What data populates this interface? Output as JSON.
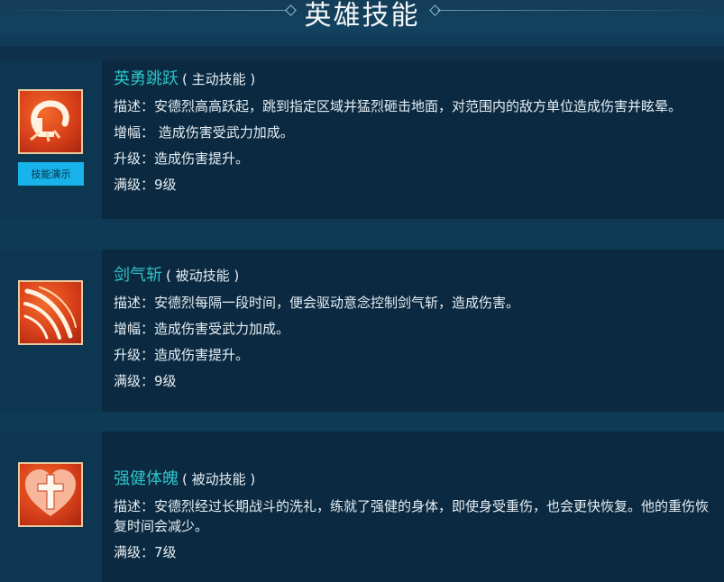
{
  "page": {
    "title": "英雄技能"
  },
  "skills": [
    {
      "name": "英勇跳跃",
      "type": "( 主动技能 )",
      "description": "描述：安德烈高高跃起，跳到指定区域并猛烈砸击地面，对范围内的敌方单位造成伤害并眩晕。",
      "boost": "增幅： 造成伤害受武力加成。",
      "upgrade": "升级：造成伤害提升。",
      "max_level": "满级：9级",
      "demo_label": "技能演示",
      "icon": "leap-slam-icon"
    },
    {
      "name": "剑气斩",
      "type": "( 被动技能 )",
      "description": "描述：安德烈每隔一段时间，便会驱动意念控制剑气斩，造成伤害。",
      "boost": "增幅：造成伤害受武力加成。",
      "upgrade": "升级：造成伤害提升。",
      "max_level": "满级：9级",
      "icon": "sword-wave-icon"
    },
    {
      "name": "强健体魄",
      "type": "( 被动技能 )",
      "description": "描述：安德烈经过长期战斗的洗礼，练就了强健的身体，即使身受重伤，也会更快恢复。他的重伤恢复时间会减少。",
      "max_level": "满级：7级",
      "icon": "heart-cross-icon"
    }
  ],
  "colors": {
    "accent": "#2ec3c9",
    "button": "#17b3ea",
    "icon_bg": "#d8401a"
  }
}
